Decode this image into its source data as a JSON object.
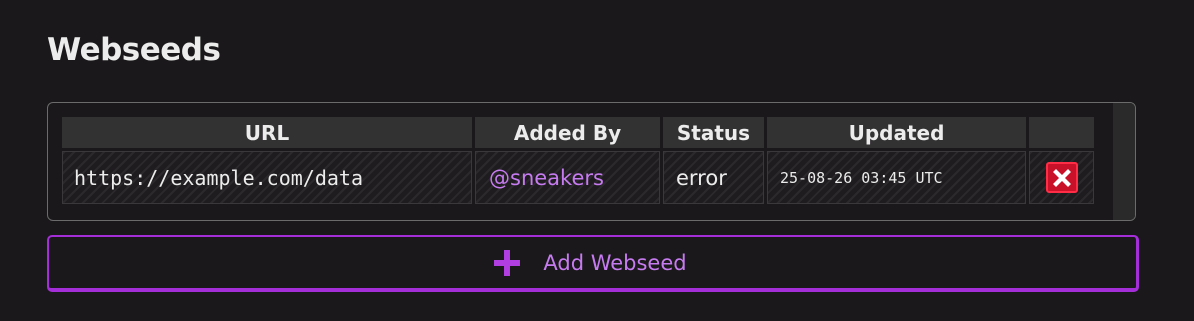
{
  "section": {
    "title": "Webseeds"
  },
  "table": {
    "columns": [
      "URL",
      "Added By",
      "Status",
      "Updated",
      ""
    ],
    "rows": [
      {
        "url": "https://example.com/data",
        "added_by": "@sneakers",
        "status": "error",
        "updated": "25-08-26 03:45 UTC",
        "delete_icon": "x-icon"
      }
    ]
  },
  "add_button": {
    "label": "Add Webseed",
    "icon": "plus-icon"
  },
  "colors": {
    "background": "#1a181a",
    "accent": "#a42fd8",
    "link": "#c67bf0",
    "danger": "#c9122a",
    "header_bg": "#333233"
  }
}
